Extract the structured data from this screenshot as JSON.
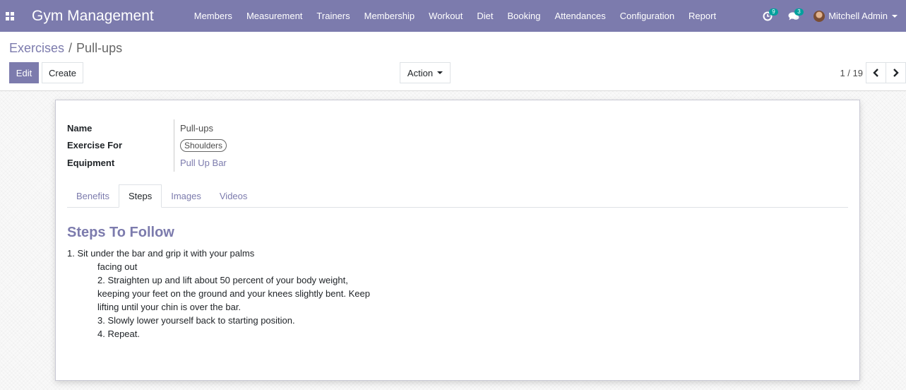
{
  "navbar": {
    "brand": "Gym Management",
    "menu": [
      "Members",
      "Measurement",
      "Trainers",
      "Membership",
      "Workout",
      "Diet",
      "Booking",
      "Attendances",
      "Configuration",
      "Report"
    ],
    "activity_count": "9",
    "messages_count": "3",
    "user_name": "Mitchell Admin"
  },
  "breadcrumb": {
    "parent": "Exercises",
    "separator": "/",
    "current": "Pull-ups"
  },
  "buttons": {
    "edit": "Edit",
    "create": "Create",
    "action": "Action"
  },
  "pager": {
    "value": "1 / 19"
  },
  "form": {
    "fields": [
      {
        "label": "Name",
        "value": "Pull-ups"
      },
      {
        "label": "Exercise For",
        "value": "Shoulders"
      },
      {
        "label": "Equipment",
        "value": "Pull Up Bar"
      }
    ],
    "tabs": [
      "Benefits",
      "Steps",
      "Images",
      "Videos"
    ],
    "active_tab": "Steps",
    "steps_title": "Steps To Follow",
    "steps_lines": [
      "1. Sit under the bar and grip it with your palms",
      "facing out",
      "2. Straighten up and lift about 50 percent of your body weight,",
      "keeping your feet on the ground and your knees slightly bent. Keep",
      "lifting until your chin is over the bar.",
      "3. Slowly lower yourself back to starting position.",
      "4. Repeat."
    ]
  },
  "colors": {
    "brand": "#7c7bad",
    "badge": "#00a09d"
  }
}
